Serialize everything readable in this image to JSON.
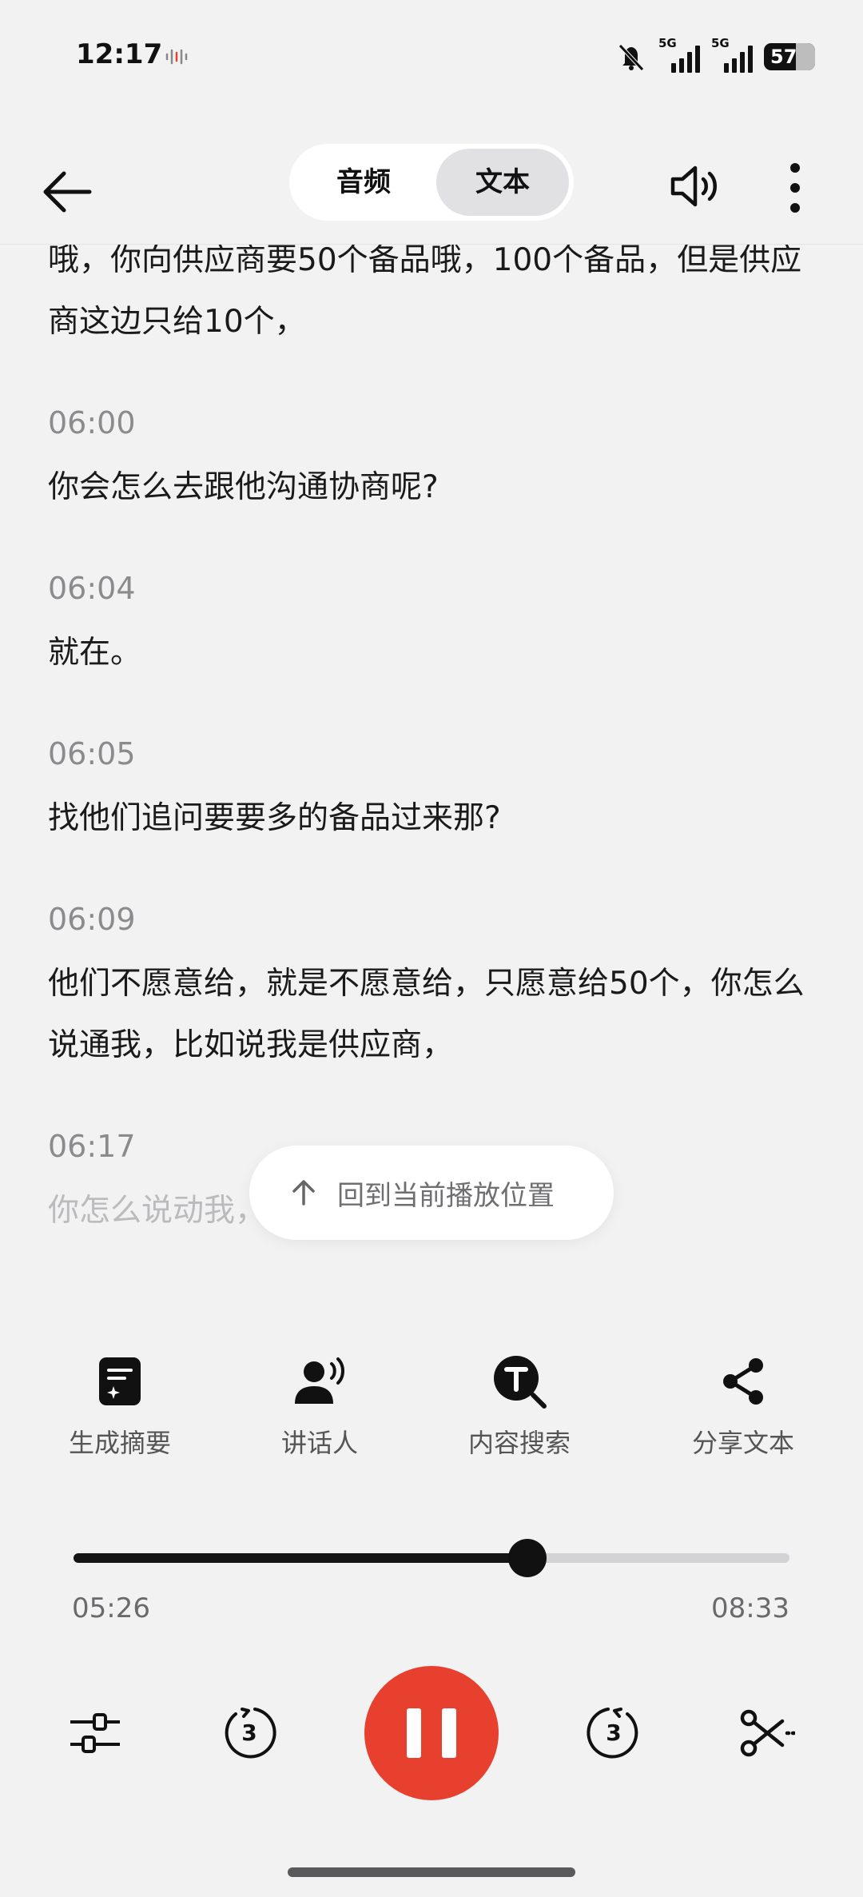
{
  "status_bar": {
    "time": "12:17",
    "signal_1": "5G",
    "signal_2": "5G",
    "battery": "57"
  },
  "header": {
    "tabs": [
      "音频",
      "文本"
    ],
    "active_tab": "文本"
  },
  "transcript": {
    "top_text": "哦，你向供应商要50个备品哦，100个备品，但是供应商这边只给10个，",
    "segments": [
      {
        "time": "06:00",
        "text": "你会怎么去跟他沟通协商呢?"
      },
      {
        "time": "06:04",
        "text": "就在。"
      },
      {
        "time": "06:05",
        "text": "找他们追问要要多的备品过来那?"
      },
      {
        "time": "06:09",
        "text": "他们不愿意给，就是不愿意给，只愿意给50个，你怎么说通我，比如说我是供应商，"
      },
      {
        "time": "06:17",
        "text": "你怎么说动我，让我给你这50个备品呢?"
      }
    ]
  },
  "back_to_position": {
    "label": "回到当前播放位置"
  },
  "tools": [
    {
      "label": "生成摘要",
      "icon": "summary-icon"
    },
    {
      "label": "讲话人",
      "icon": "speaker-person-icon"
    },
    {
      "label": "内容搜索",
      "icon": "text-search-icon"
    },
    {
      "label": "分享文本",
      "icon": "share-icon"
    }
  ],
  "player": {
    "current_time": "05:26",
    "total_time": "08:33",
    "progress": 0.634,
    "rewind_seconds": "3",
    "forward_seconds": "3",
    "accent_color": "#e8402f"
  }
}
